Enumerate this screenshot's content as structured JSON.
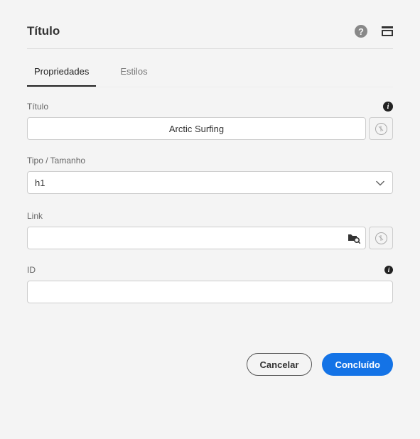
{
  "header": {
    "title": "Título"
  },
  "tabs": {
    "properties": "Propriedades",
    "styles": "Estilos"
  },
  "fields": {
    "title": {
      "label": "Título",
      "value": "Arctic Surfing"
    },
    "type": {
      "label": "Tipo / Tamanho",
      "value": "h1"
    },
    "link": {
      "label": "Link",
      "value": ""
    },
    "id": {
      "label": "ID",
      "value": ""
    }
  },
  "footer": {
    "cancel": "Cancelar",
    "done": "Concluído"
  }
}
